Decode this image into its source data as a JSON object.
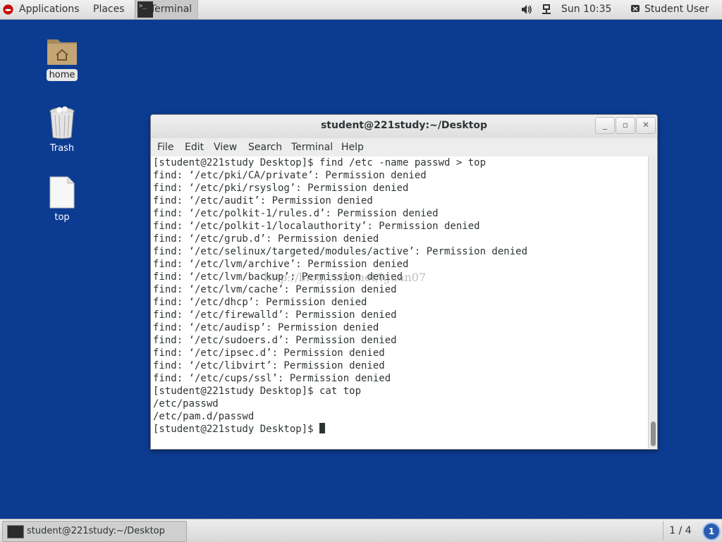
{
  "top_panel": {
    "applications_label": "Applications",
    "places_label": "Places",
    "terminal_label": "Terminal",
    "clock": "Sun 10:35",
    "user": "Student User"
  },
  "desktop": {
    "icons": [
      {
        "label": "home",
        "icon": "home-folder-icon"
      },
      {
        "label": "Trash",
        "icon": "trash-icon"
      },
      {
        "label": "top",
        "icon": "file-icon"
      }
    ]
  },
  "window": {
    "title": "student@221study:~/Desktop",
    "menu": [
      "File",
      "Edit",
      "View",
      "Search",
      "Terminal",
      "Help"
    ],
    "lines": [
      "[student@221study Desktop]$ find /etc -name passwd > top",
      "find: ‘/etc/pki/CA/private’: Permission denied",
      "find: ‘/etc/pki/rsyslog’: Permission denied",
      "find: ‘/etc/audit’: Permission denied",
      "find: ‘/etc/polkit-1/rules.d’: Permission denied",
      "find: ‘/etc/polkit-1/localauthority’: Permission denied",
      "find: ‘/etc/grub.d’: Permission denied",
      "find: ‘/etc/selinux/targeted/modules/active’: Permission denied",
      "find: ‘/etc/lvm/archive’: Permission denied",
      "find: ‘/etc/lvm/backup’: Permission denied",
      "find: ‘/etc/lvm/cache’: Permission denied",
      "find: ‘/etc/dhcp’: Permission denied",
      "find: ‘/etc/firewalld’: Permission denied",
      "find: ‘/etc/audisp’: Permission denied",
      "find: ‘/etc/sudoers.d’: Permission denied",
      "find: ‘/etc/ipsec.d’: Permission denied",
      "find: ‘/etc/libvirt’: Permission denied",
      "find: ‘/etc/cups/ssl’: Permission denied",
      "[student@221study Desktop]$ cat top",
      "/etc/passwd",
      "/etc/pam.d/passwd",
      "[student@221study Desktop]$ "
    ],
    "watermark": "http://blog.csdn.net/lguan07"
  },
  "bottom_panel": {
    "task_label": "student@221study:~/Desktop",
    "workspace": "1 / 4",
    "notification_count": "1"
  }
}
